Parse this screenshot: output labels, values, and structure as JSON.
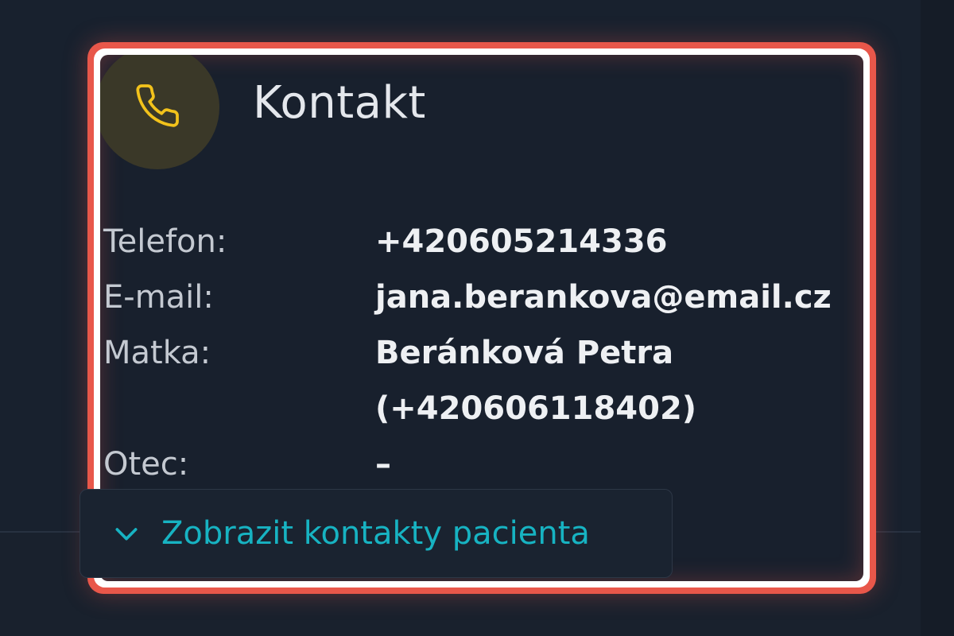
{
  "card": {
    "title": "Kontakt",
    "icon": "phone-icon",
    "icon_color": "#f2c21b",
    "rows": [
      {
        "label": "Telefon:",
        "value": "+420605214336"
      },
      {
        "label": "E-mail:",
        "value": "jana.berankova@email.cz"
      },
      {
        "label": "Matka:",
        "value": "Beránková Petra"
      },
      {
        "label": "",
        "value": "(+420606118402)"
      },
      {
        "label": "Otec:",
        "value": "–"
      }
    ]
  },
  "expand_button": {
    "label": "Zobrazit kontakty pacienta",
    "icon": "chevron-down-icon",
    "color": "#17b3c2"
  },
  "highlight_color": "#e8574a"
}
